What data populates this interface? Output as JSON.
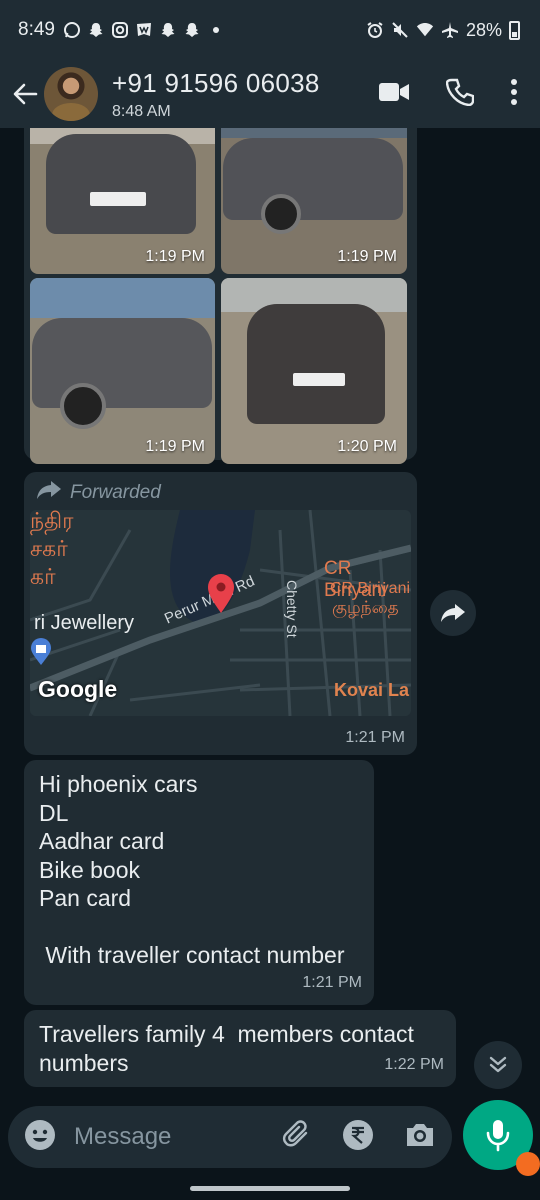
{
  "status_bar": {
    "time": "8:49",
    "battery": "28%",
    "icons": [
      "whatsapp-icon",
      "snapchat-icon",
      "instagram-icon",
      "webtoon-icon",
      "snapchat-icon",
      "snapchat-icon",
      "alarm-icon",
      "mute-icon",
      "wifi-icon",
      "airplane-icon",
      "battery-icon"
    ]
  },
  "header": {
    "title": "+91 91596 06038",
    "subtitle": "8:48 AM"
  },
  "images": {
    "timestamps": [
      "1:19 PM",
      "1:19 PM",
      "1:19 PM",
      "1:20 PM"
    ]
  },
  "location_msg": {
    "forwarded_label": "Forwarded",
    "map_labels": {
      "road": "Perur Main Rd",
      "street": "Chetty St",
      "place1": "CR Biriyani",
      "place2": "CR Biriyani",
      "tamil1": "குழந்தை",
      "jewellery": "ri Jewellery",
      "tamil_left1": "ந்திர",
      "tamil_left2": "சகர்",
      "tamil_left3": "கர்",
      "kovai": "Kovai La",
      "google": "Google"
    },
    "time": "1:21 PM"
  },
  "messages": [
    {
      "lines": [
        "Hi phoenix cars",
        "DL",
        "Aadhar card",
        "Bike book",
        "Pan card",
        "",
        " With traveller contact number"
      ],
      "time": "1:21 PM"
    },
    {
      "lines": [
        "Travellers family 4  members contact",
        "numbers"
      ],
      "time": "1:22 PM"
    }
  ],
  "input": {
    "placeholder": "Message"
  },
  "colors": {
    "bg": "#0b141a",
    "bubble": "#202c33",
    "accent": "#00a884"
  }
}
